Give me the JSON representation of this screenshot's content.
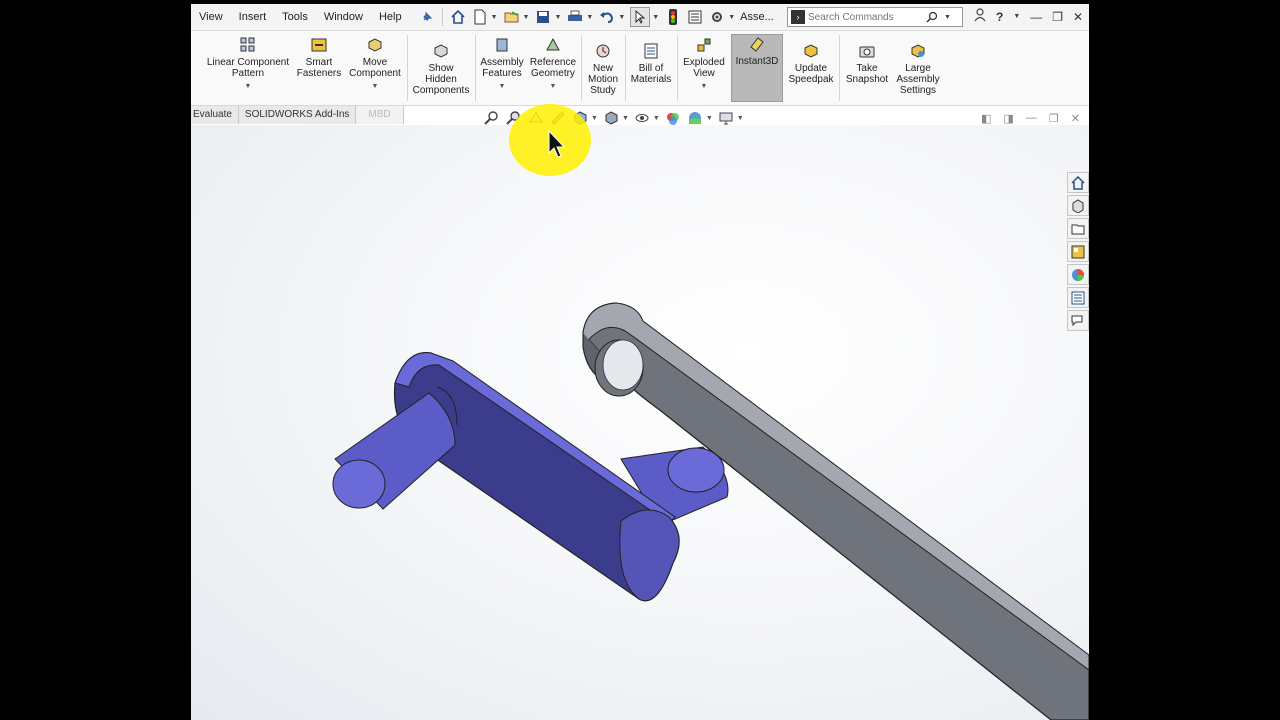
{
  "menu": [
    "View",
    "Insert",
    "Tools",
    "Window",
    "Help"
  ],
  "quick_access": {
    "icons": [
      "pin-icon",
      "home-icon",
      "new-document-icon",
      "open-icon",
      "save-icon",
      "print-icon",
      "undo-icon",
      "select-icon",
      "traffic-light-icon",
      "file-properties-icon",
      "options-icon"
    ],
    "assembly_label": "Asse..."
  },
  "search": {
    "placeholder": "Search Commands"
  },
  "window_controls": [
    "user-icon",
    "help-icon",
    "minimize-icon",
    "restore-icon",
    "close-icon"
  ],
  "ribbon": {
    "buttons": [
      {
        "label": "Linear Component\nPattern",
        "icon": "linear-pattern-icon"
      },
      {
        "label": "Smart\nFasteners",
        "icon": "smart-fasteners-icon"
      },
      {
        "label": "Move\nComponent",
        "icon": "move-component-icon"
      },
      {
        "label": "Show\nHidden\nComponents",
        "icon": "show-hidden-icon"
      },
      {
        "label": "Assembly\nFeatures",
        "icon": "assembly-features-icon"
      },
      {
        "label": "Reference\nGeometry",
        "icon": "reference-geometry-icon"
      },
      {
        "label": "New\nMotion\nStudy",
        "icon": "motion-study-icon"
      },
      {
        "label": "Bill of\nMaterials",
        "icon": "bom-icon"
      },
      {
        "label": "Exploded\nView",
        "icon": "exploded-view-icon"
      },
      {
        "label": "Instant3D",
        "icon": "instant3d-icon",
        "active": true
      },
      {
        "label": "Update\nSpeedpak",
        "icon": "speedpak-icon"
      },
      {
        "label": "Take\nSnapshot",
        "icon": "snapshot-icon"
      },
      {
        "label": "Large\nAssembly\nSettings",
        "icon": "large-assembly-icon"
      }
    ]
  },
  "tabs": [
    "Evaluate",
    "SOLIDWORKS Add-Ins",
    "MBD"
  ],
  "heads_up_toolbar": [
    "zoom-to-fit-icon",
    "zoom-area-icon",
    "previous-view-icon",
    "section-view-icon",
    "view-orientation-icon",
    "display-style-icon",
    "hide-show-icon",
    "edit-appearance-icon",
    "apply-scene-icon",
    "view-settings-icon"
  ],
  "task_pane": [
    "solidworks-resources-icon",
    "design-library-icon",
    "file-explorer-icon",
    "view-palette-icon",
    "appearances-icon",
    "custom-properties-icon",
    "forum-icon"
  ],
  "colors": {
    "crank": "#6a6ad8",
    "crank_dark": "#3c3c8c",
    "link": "#6f737c",
    "link_light": "#a4a7b0",
    "highlight": "#fff000"
  }
}
